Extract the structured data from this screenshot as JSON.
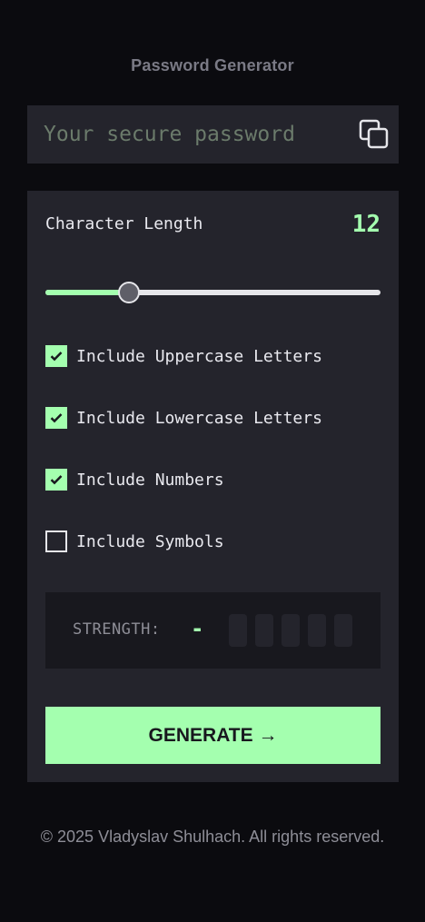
{
  "app": {
    "title": "Password Generator"
  },
  "password": {
    "value": "",
    "placeholder": "Your secure password",
    "copy_icon": "copy-icon"
  },
  "length": {
    "label": "Character Length",
    "value": "12",
    "slider_fraction": 0.25
  },
  "options": [
    {
      "label": "Include Uppercase Letters",
      "checked": true
    },
    {
      "label": "Include Lowercase Letters",
      "checked": true
    },
    {
      "label": "Include Numbers",
      "checked": true
    },
    {
      "label": "Include Symbols",
      "checked": false
    }
  ],
  "strength": {
    "label": "STRENGTH:",
    "value": "-",
    "bars_filled": 0,
    "bars_total": 5
  },
  "generate": {
    "label": "GENERATE →"
  },
  "footer": {
    "text": "© 2025 Vladyslav Shulhach. All rights reserved."
  },
  "colors": {
    "accent": "#a4ffaf",
    "background": "#0b0b0f",
    "panel": "#24242c",
    "strength_panel": "#18181e"
  }
}
